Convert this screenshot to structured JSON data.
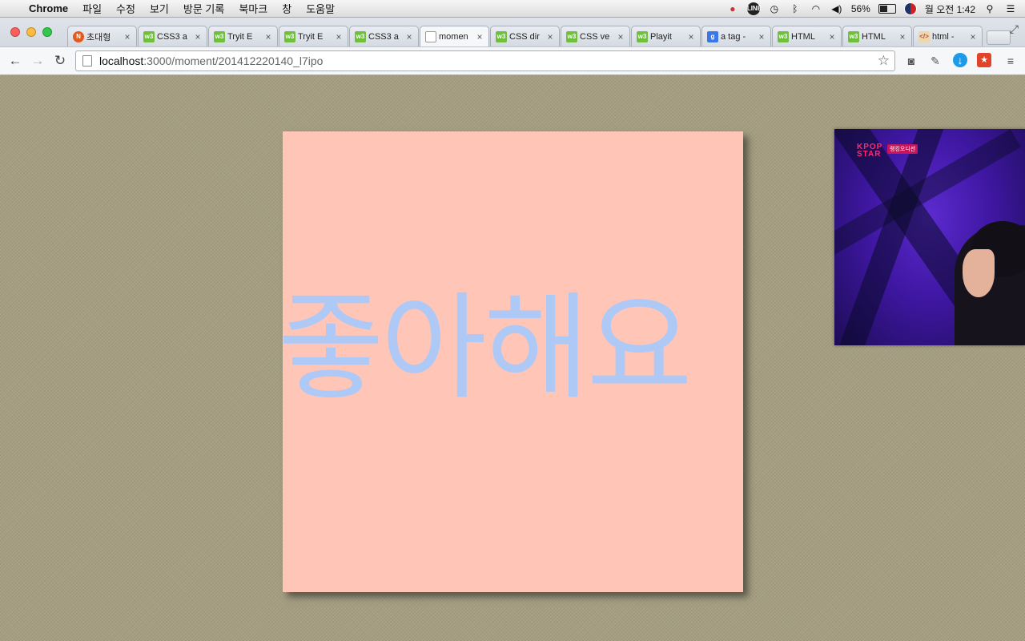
{
  "menubar": {
    "apple": "",
    "app_name": "Chrome",
    "items": [
      "파일",
      "수정",
      "보기",
      "방문 기록",
      "북마크",
      "창",
      "도움말"
    ],
    "status": {
      "line_label": "LINE",
      "battery_percent": "56%",
      "battery_level": 0.56,
      "clock": "월 오전 1:42"
    }
  },
  "browser": {
    "tabs": [
      {
        "title": "초대형",
        "favicon": "gn-icon",
        "active": false
      },
      {
        "title": "CSS3 a",
        "favicon": "w3-icon",
        "active": false
      },
      {
        "title": "Tryit E",
        "favicon": "w3-icon",
        "active": false
      },
      {
        "title": "Tryit E",
        "favicon": "w3-icon",
        "active": false
      },
      {
        "title": "CSS3 a",
        "favicon": "w3-icon",
        "active": false
      },
      {
        "title": "momen",
        "favicon": "page-icon",
        "active": true
      },
      {
        "title": "CSS dir",
        "favicon": "w3-icon",
        "active": false
      },
      {
        "title": "CSS ve",
        "favicon": "w3-icon",
        "active": false
      },
      {
        "title": "Playit",
        "favicon": "w3-icon",
        "active": false
      },
      {
        "title": "a tag -",
        "favicon": "google-icon",
        "active": false
      },
      {
        "title": "HTML",
        "favicon": "w3-icon",
        "active": false
      },
      {
        "title": "HTML",
        "favicon": "w3-icon",
        "active": false
      },
      {
        "title": "html -",
        "favicon": "code-icon",
        "active": false
      }
    ],
    "url": {
      "host": "localhost",
      "path": ":3000/moment/201412220140_l7ipo"
    }
  },
  "page": {
    "card_text": "좋아해요",
    "video_logo": "KPOP STAR",
    "video_tag": "랭킹오디션"
  },
  "colors": {
    "page_background": "#a59e82",
    "card_background": "#ffc6b8",
    "card_text": "#afc9f7"
  }
}
